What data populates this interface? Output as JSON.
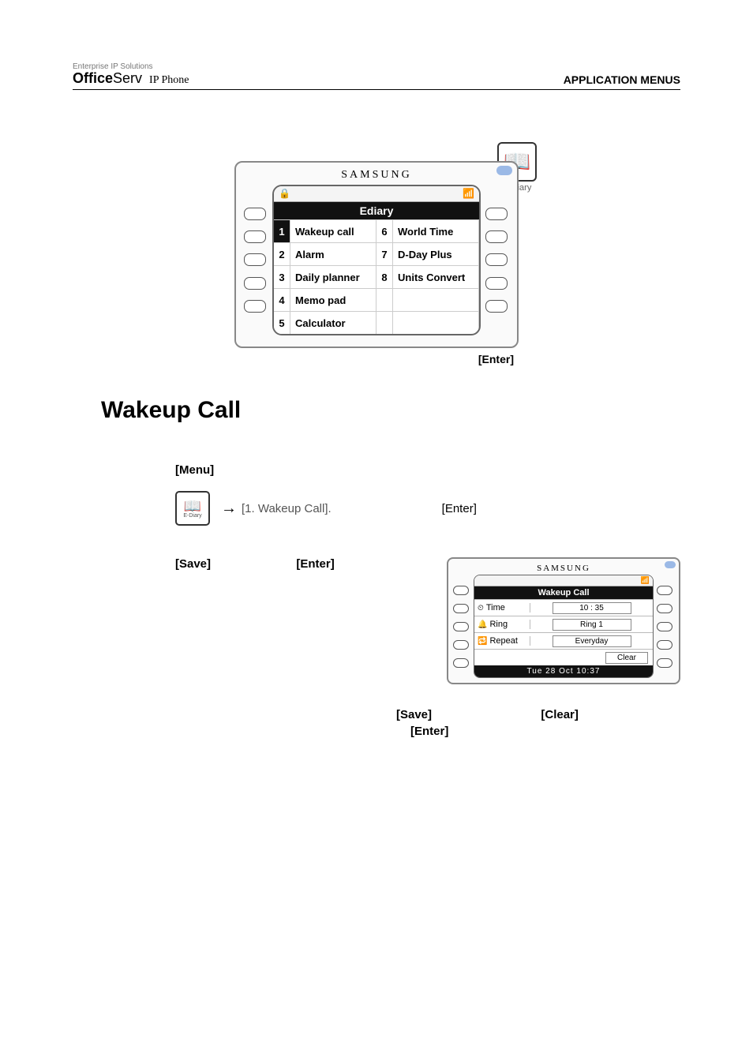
{
  "header": {
    "brand_small": "Enterprise IP Solutions",
    "brand_bold": "Office",
    "brand_light": "Serv",
    "brand_sub": "IP Phone",
    "right": "APPLICATION MENUS"
  },
  "ediary": {
    "glyph": "📖",
    "label": "E-Diary"
  },
  "main_screen": {
    "brand": "SAMSUNG",
    "status_left": "🔒",
    "status_right": "📶",
    "title": "Ediary",
    "items_left": [
      {
        "num": "1",
        "label": "Wakeup call",
        "selected": true
      },
      {
        "num": "2",
        "label": "Alarm",
        "selected": false
      },
      {
        "num": "3",
        "label": "Daily planner",
        "selected": false
      },
      {
        "num": "4",
        "label": "Memo pad",
        "selected": false
      },
      {
        "num": "5",
        "label": "Calculator",
        "selected": false
      }
    ],
    "items_right": [
      {
        "num": "6",
        "label": "World Time"
      },
      {
        "num": "7",
        "label": "D-Day Plus"
      },
      {
        "num": "8",
        "label": "Units Convert"
      }
    ],
    "enter_label": "[Enter]"
  },
  "section": {
    "title": "Wakeup Call"
  },
  "steps": {
    "menu_label": "[Menu]",
    "arrow": "→",
    "item_label": "[1. Wakeup Call].",
    "enter_label": "[Enter]"
  },
  "mini_icon": {
    "glyph": "📖",
    "label": "E-Diary"
  },
  "save_line": {
    "save_label": "[Save]",
    "enter_label": "[Enter]"
  },
  "small_screen": {
    "brand": "SAMSUNG",
    "status_right": "📶",
    "title": "Wakeup Call",
    "rows": [
      {
        "icon": "⏲",
        "label": "Time",
        "value": "10 : 35"
      },
      {
        "icon": "🔔",
        "label": "Ring",
        "value": "Ring 1"
      },
      {
        "icon": "🔁",
        "label": "Repeat",
        "value": "Everyday"
      }
    ],
    "soft_right": "Clear",
    "clock": "Tue 28 Oct 10:37"
  },
  "final": {
    "save_label": "[Save]",
    "clear_label": "[Clear]",
    "enter_label": "[Enter]"
  }
}
